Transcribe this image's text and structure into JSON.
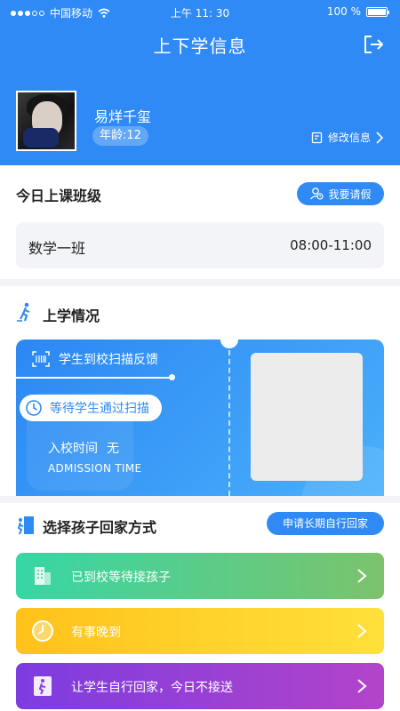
{
  "status_bar": {
    "carrier": "中国移动",
    "time": "上午 11: 30",
    "battery": "100 %",
    "battery_level": 1.0
  },
  "header": {
    "title": "上下学信息",
    "user_name": "易烊千玺",
    "age_label": "年龄:12",
    "edit_label": "修改信息"
  },
  "today": {
    "title": "今日上课班级",
    "leave_button": "我要请假",
    "class_name": "数学一班",
    "class_time": "08:00-11:00"
  },
  "attendance": {
    "title": "上学情况",
    "scan_feedback": "学生到校扫描反馈",
    "waiting": "等待学生通过扫描",
    "enter_time_label": "入校时间",
    "enter_time_value": "无",
    "enter_time_en": "ADMISSION TIME"
  },
  "go_home": {
    "title": "选择孩子回家方式",
    "long_term_button": "申请长期自行回家",
    "options": [
      {
        "label": "已到校等待接孩子",
        "icon": "building-icon",
        "color": "#37d6a6"
      },
      {
        "label": "有事晚到",
        "icon": "clock-icon",
        "color": "#ffc21a"
      },
      {
        "label": "让学生自行回家，今日不接送",
        "icon": "exit-door-icon",
        "color": "#8b3fde"
      }
    ]
  },
  "colors": {
    "primary": "#2f8af5",
    "background": "#f2f3f7"
  }
}
